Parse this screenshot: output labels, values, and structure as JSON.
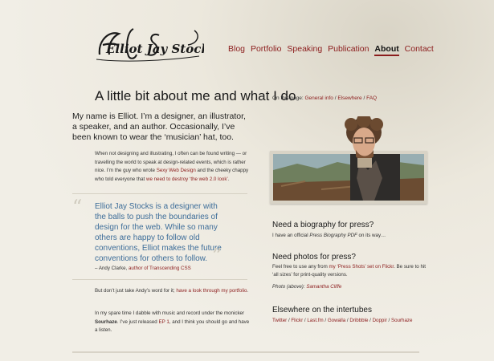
{
  "logo": {
    "text": "Elliot Jay Stocks"
  },
  "nav": {
    "items": [
      {
        "label": "Blog"
      },
      {
        "label": "Portfolio"
      },
      {
        "label": "Speaking"
      },
      {
        "label": "Publication"
      },
      {
        "label": "About"
      },
      {
        "label": "Contact"
      }
    ],
    "active": "About"
  },
  "page": {
    "title": "A little bit about me and what I do",
    "intro": "My name is Elliot. I’m a designer, an illustrator, a speaker, and an author. Occasionally, I’ve been known to wear the ‘musician’ hat, too.",
    "body1": {
      "p1": "When not designing and illustrating, I often can be found writing — or travelling the world to speak at design-related events, which is rather nice. I’m the guy who wrote ",
      "link1": "Sexy Web Design",
      "p2": " and the cheeky chappy who told everyone that ",
      "link2": "we need to destroy ‘the web 2.0 look’",
      "p3": "."
    },
    "quote": {
      "text": "Elliot Jay Stocks is a designer with the balls to push the boundaries of design for the web. While so many others are happy to follow old conventions, Elliot makes the future conventions for others to follow.",
      "attribution_prefix": "– Andy Clarke, ",
      "attribution_link": "author of Transcending CSS",
      "open_mark": "“",
      "close_mark": "”"
    },
    "body2": {
      "p1": "But don’t just take Andy’s word for it; ",
      "link1": "have a look through my portfolio",
      "p2": "."
    },
    "body3": {
      "p1": "In my spare time I dabble with music and record under the monicker ",
      "bold": "Sourhaze",
      "p2": ". I’ve just released ",
      "link1": "EP 1",
      "p3": ", and I think you should go and have a listen."
    }
  },
  "sidebar": {
    "on_this_page_label": "On this page: ",
    "on_this_page_links": [
      "General info",
      "Elsewhere",
      "FAQ"
    ],
    "bio": {
      "heading": "Need a biography for press?",
      "text_prefix": "I have an official ",
      "text_em": "Press Biography PDF",
      "text_suffix": " on its way…"
    },
    "photos": {
      "heading": "Need photos for press?",
      "text_prefix": "Feel free to use any from ",
      "link": "my ‘Press Shots’ set on Flickr",
      "text_suffix": ". Be sure to hit ‘all sizes’ for print-quality versions.",
      "caption_prefix": "Photo (above): ",
      "caption_link": "Samantha Cliffe"
    },
    "elsewhere": {
      "heading": "Elsewhere on the intertubes",
      "links": [
        "Twitter",
        "Flickr",
        "Last.fm",
        "Gowalla",
        "Dribbble",
        "Doppir",
        "Sourhaze"
      ]
    }
  },
  "colors": {
    "link": "#8b1c1c",
    "quote": "#3d6d99",
    "background": "#efece2"
  }
}
